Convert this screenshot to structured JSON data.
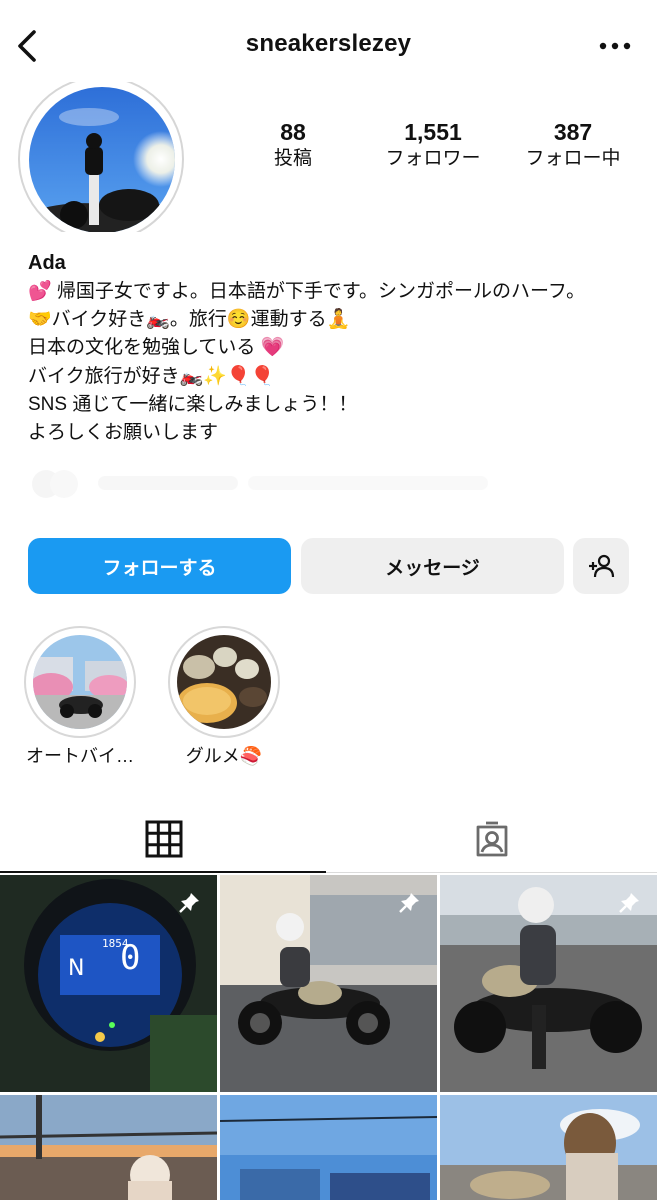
{
  "header": {
    "username": "sneakerslezey",
    "back_icon": "chevron-left-icon",
    "more_icon": "ellipsis-icon"
  },
  "stats": {
    "posts": {
      "value": "88",
      "label": "投稿"
    },
    "followers": {
      "value": "1,551",
      "label": "フォロワー"
    },
    "following": {
      "value": "387",
      "label": "フォロー中"
    }
  },
  "bio": {
    "name": "Ada",
    "lines": [
      "💕 帰国子女ですよ。日本語が下手です。シンガポールのハーフ。",
      "🤝バイク好き🏍️。旅行☺️運動する🧘",
      "日本の文化を勉強している 💗",
      "バイク旅行が好き🏍️✨🎈🎈",
      "SNS 通じて一緒に楽しみましょう！！",
      "よろしくお願いします"
    ]
  },
  "actions": {
    "follow": "フォローする",
    "message": "メッセージ",
    "add_user_icon": "add-user-icon"
  },
  "highlights": [
    {
      "label": "オートバイ…"
    },
    {
      "label": "グルメ🍣"
    }
  ],
  "tabs": [
    {
      "icon": "grid-icon",
      "active": true
    },
    {
      "icon": "tagged-icon",
      "active": false
    }
  ],
  "colors": {
    "accent": "#1a9af2",
    "button_gray": "#efefef"
  }
}
